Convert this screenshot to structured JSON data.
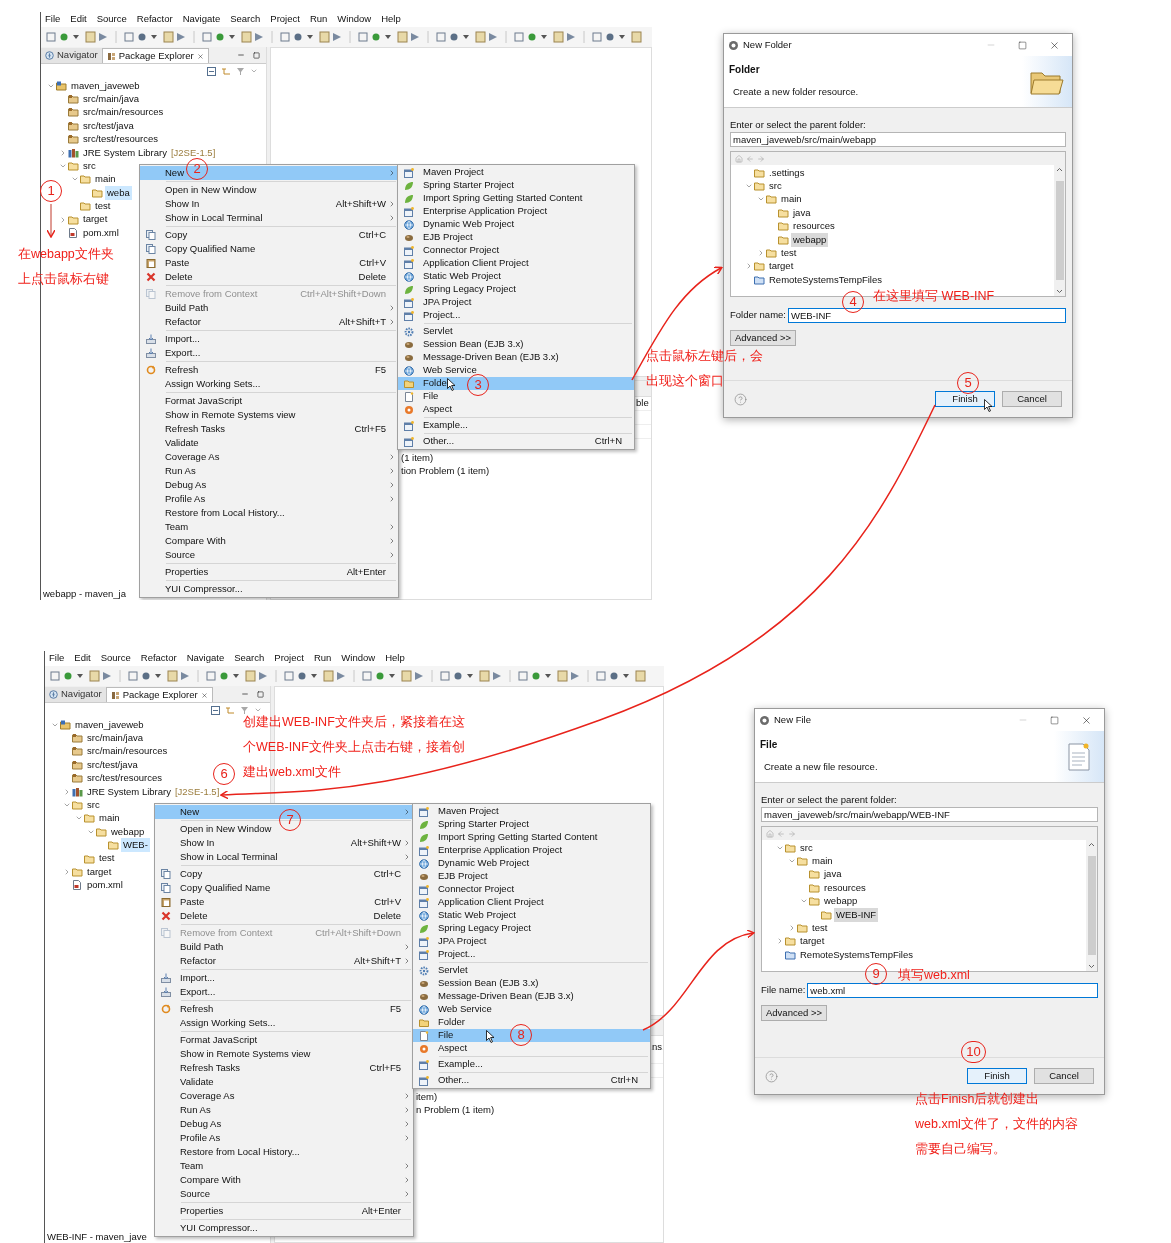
{
  "panels": [
    {
      "menu_bar": [
        "File",
        "Edit",
        "Source",
        "Refactor",
        "Navigate",
        "Search",
        "Project",
        "Run",
        "Window",
        "Help"
      ],
      "tabs": [
        {
          "label": "Navigator",
          "selected": false
        },
        {
          "label": "Package Explorer",
          "selected": true
        }
      ],
      "tree": [
        {
          "label": "maven_javeweb",
          "kind": "project",
          "expanded": true,
          "selected": false,
          "children": [
            {
              "label": "src/main/java",
              "kind": "package",
              "selected": false
            },
            {
              "label": "src/main/resources",
              "kind": "package",
              "selected": false
            },
            {
              "label": "src/test/java",
              "kind": "package",
              "selected": false
            },
            {
              "label": "src/test/resources",
              "kind": "package",
              "selected": false
            },
            {
              "label": "JRE System Library",
              "decoration": "[J2SE-1.5]",
              "kind": "library",
              "expanded": false,
              "selected": false
            },
            {
              "label": "src",
              "kind": "folder",
              "expanded": true,
              "selected": false,
              "children": [
                {
                  "label": "main",
                  "kind": "folder",
                  "expanded": true,
                  "selected": false,
                  "children": [
                    {
                      "label": "weba",
                      "kind": "folder",
                      "selected": true
                    }
                  ]
                },
                {
                  "label": "test",
                  "kind": "folder",
                  "selected": false
                }
              ]
            },
            {
              "label": "target",
              "kind": "folder",
              "expanded": false,
              "selected": false
            },
            {
              "label": "pom.xml",
              "kind": "xml",
              "selected": false
            }
          ]
        }
      ],
      "status": "webapp - maven_ja",
      "fragments": [
        "ble",
        "(1 item)",
        "tion Problem (1 item)"
      ],
      "context_menu": {
        "groups": [
          [
            {
              "label": "New",
              "submenu": true,
              "selected": true,
              "disabled": false
            }
          ],
          [
            {
              "label": "Open in New Window",
              "submenu": false,
              "selected": false,
              "disabled": false
            },
            {
              "label": "Show In",
              "shortcut": "Alt+Shift+W",
              "submenu": true,
              "selected": false,
              "disabled": false
            },
            {
              "label": "Show in Local Terminal",
              "submenu": true,
              "selected": false,
              "disabled": false
            }
          ],
          [
            {
              "label": "Copy",
              "shortcut": "Ctrl+C",
              "kind": "copy",
              "submenu": false,
              "selected": false,
              "disabled": false
            },
            {
              "label": "Copy Qualified Name",
              "kind": "copy",
              "submenu": false,
              "selected": false,
              "disabled": false
            },
            {
              "label": "Paste",
              "shortcut": "Ctrl+V",
              "kind": "paste",
              "submenu": false,
              "selected": false,
              "disabled": false
            },
            {
              "label": "Delete",
              "shortcut": "Delete",
              "kind": "delete",
              "submenu": false,
              "selected": false,
              "disabled": false
            }
          ],
          [
            {
              "label": "Remove from Context",
              "shortcut": "Ctrl+Alt+Shift+Down",
              "kind": "remove",
              "submenu": false,
              "selected": false,
              "disabled": true
            },
            {
              "label": "Build Path",
              "submenu": true,
              "selected": false,
              "disabled": false
            },
            {
              "label": "Refactor",
              "shortcut": "Alt+Shift+T",
              "submenu": true,
              "selected": false,
              "disabled": false
            }
          ],
          [
            {
              "label": "Import...",
              "kind": "import",
              "submenu": false,
              "selected": false,
              "disabled": false
            },
            {
              "label": "Export...",
              "kind": "export",
              "submenu": false,
              "selected": false,
              "disabled": false
            }
          ],
          [
            {
              "label": "Refresh",
              "shortcut": "F5",
              "kind": "refresh",
              "submenu": false,
              "selected": false,
              "disabled": false
            },
            {
              "label": "Assign Working Sets...",
              "submenu": false,
              "selected": false,
              "disabled": false
            }
          ],
          [
            {
              "label": "Format JavaScript",
              "submenu": false,
              "selected": false,
              "disabled": false
            },
            {
              "label": "Show in Remote Systems view",
              "submenu": false,
              "selected": false,
              "disabled": false
            },
            {
              "label": "Refresh Tasks",
              "shortcut": "Ctrl+F5",
              "submenu": false,
              "selected": false,
              "disabled": false
            },
            {
              "label": "Validate",
              "submenu": false,
              "selected": false,
              "disabled": false
            },
            {
              "label": "Coverage As",
              "submenu": true,
              "selected": false,
              "disabled": false
            },
            {
              "label": "Run As",
              "submenu": true,
              "selected": false,
              "disabled": false
            },
            {
              "label": "Debug As",
              "submenu": true,
              "selected": false,
              "disabled": false
            },
            {
              "label": "Profile As",
              "submenu": true,
              "selected": false,
              "disabled": false
            },
            {
              "label": "Restore from Local History...",
              "submenu": false,
              "selected": false,
              "disabled": false
            },
            {
              "label": "Team",
              "submenu": true,
              "selected": false,
              "disabled": false
            },
            {
              "label": "Compare With",
              "submenu": true,
              "selected": false,
              "disabled": false
            },
            {
              "label": "Source",
              "submenu": true,
              "selected": false,
              "disabled": false
            }
          ],
          [
            {
              "label": "Properties",
              "shortcut": "Alt+Enter",
              "submenu": false,
              "selected": false,
              "disabled": false
            }
          ],
          [
            {
              "label": "YUI Compressor...",
              "submenu": false,
              "selected": false,
              "disabled": false
            }
          ]
        ]
      },
      "new_submenu": {
        "groups": [
          [
            {
              "label": "Maven Project",
              "kind": "wizard",
              "selected": false
            },
            {
              "label": "Spring Starter Project",
              "kind": "spring",
              "selected": false
            },
            {
              "label": "Import Spring Getting Started Content",
              "kind": "spring",
              "selected": false
            },
            {
              "label": "Enterprise Application Project",
              "kind": "wizard",
              "selected": false
            },
            {
              "label": "Dynamic Web Project",
              "kind": "web",
              "selected": false
            },
            {
              "label": "EJB Project",
              "kind": "bean",
              "selected": false
            },
            {
              "label": "Connector Project",
              "kind": "wizard",
              "selected": false
            },
            {
              "label": "Application Client Project",
              "kind": "wizard",
              "selected": false
            },
            {
              "label": "Static Web Project",
              "kind": "web",
              "selected": false
            },
            {
              "label": "Spring Legacy Project",
              "kind": "spring",
              "selected": false
            },
            {
              "label": "JPA Project",
              "kind": "wizard",
              "selected": false
            },
            {
              "label": "Project...",
              "kind": "wizard",
              "selected": false
            }
          ],
          [
            {
              "label": "Servlet",
              "kind": "servlet",
              "selected": false
            },
            {
              "label": "Session Bean (EJB 3.x)",
              "kind": "bean",
              "selected": false
            },
            {
              "label": "Message-Driven Bean (EJB 3.x)",
              "kind": "bean",
              "selected": false
            },
            {
              "label": "Web Service",
              "kind": "web",
              "selected": false
            },
            {
              "label": "Folder",
              "kind": "folder",
              "selected": true
            },
            {
              "label": "File",
              "kind": "file",
              "selected": false
            },
            {
              "label": "Aspect",
              "kind": "aspect",
              "selected": false
            }
          ],
          [
            {
              "label": "Example...",
              "kind": "wizard",
              "selected": false
            }
          ],
          [
            {
              "label": "Other...",
              "shortcut": "Ctrl+N",
              "kind": "wizard",
              "selected": false
            }
          ]
        ]
      }
    },
    {
      "menu_bar": [
        "File",
        "Edit",
        "Source",
        "Refactor",
        "Navigate",
        "Search",
        "Project",
        "Run",
        "Window",
        "Help"
      ],
      "tabs": [
        {
          "label": "Navigator",
          "selected": false
        },
        {
          "label": "Package Explorer",
          "selected": true
        }
      ],
      "tree": [
        {
          "label": "maven_javeweb",
          "kind": "project",
          "expanded": true,
          "selected": false,
          "children": [
            {
              "label": "src/main/java",
              "kind": "package",
              "selected": false
            },
            {
              "label": "src/main/resources",
              "kind": "package",
              "selected": false
            },
            {
              "label": "src/test/java",
              "kind": "package",
              "selected": false
            },
            {
              "label": "src/test/resources",
              "kind": "package",
              "selected": false
            },
            {
              "label": "JRE System Library",
              "decoration": "[J2SE-1.5]",
              "kind": "library",
              "expanded": false,
              "selected": false
            },
            {
              "label": "src",
              "kind": "folder",
              "expanded": true,
              "selected": false,
              "children": [
                {
                  "label": "main",
                  "kind": "folder",
                  "expanded": true,
                  "selected": false,
                  "children": [
                    {
                      "label": "webapp",
                      "kind": "folder",
                      "expanded": true,
                      "selected": false,
                      "children": [
                        {
                          "label": "WEB-",
                          "kind": "folder",
                          "selected": true
                        }
                      ]
                    }
                  ]
                },
                {
                  "label": "test",
                  "kind": "folder",
                  "selected": false
                }
              ]
            },
            {
              "label": "target",
              "kind": "folder",
              "expanded": false,
              "selected": false
            },
            {
              "label": "pom.xml",
              "kind": "xml",
              "selected": false
            }
          ]
        }
      ],
      "status": "WEB-INF - maven_jave",
      "fragments": [
        "ns",
        "item)",
        "n Problem (1 item)"
      ],
      "context_menu": {
        "groups": [
          [
            {
              "label": "New",
              "submenu": true,
              "selected": true,
              "disabled": false
            }
          ],
          [
            {
              "label": "Open in New Window",
              "submenu": false,
              "selected": false,
              "disabled": false
            },
            {
              "label": "Show In",
              "shortcut": "Alt+Shift+W",
              "submenu": true,
              "selected": false,
              "disabled": false
            },
            {
              "label": "Show in Local Terminal",
              "submenu": true,
              "selected": false,
              "disabled": false
            }
          ],
          [
            {
              "label": "Copy",
              "shortcut": "Ctrl+C",
              "kind": "copy",
              "submenu": false,
              "selected": false,
              "disabled": false
            },
            {
              "label": "Copy Qualified Name",
              "kind": "copy",
              "submenu": false,
              "selected": false,
              "disabled": false
            },
            {
              "label": "Paste",
              "shortcut": "Ctrl+V",
              "kind": "paste",
              "submenu": false,
              "selected": false,
              "disabled": false
            },
            {
              "label": "Delete",
              "shortcut": "Delete",
              "kind": "delete",
              "submenu": false,
              "selected": false,
              "disabled": false
            }
          ],
          [
            {
              "label": "Remove from Context",
              "shortcut": "Ctrl+Alt+Shift+Down",
              "kind": "remove",
              "submenu": false,
              "selected": false,
              "disabled": true
            },
            {
              "label": "Build Path",
              "submenu": true,
              "selected": false,
              "disabled": false
            },
            {
              "label": "Refactor",
              "shortcut": "Alt+Shift+T",
              "submenu": true,
              "selected": false,
              "disabled": false
            }
          ],
          [
            {
              "label": "Import...",
              "kind": "import",
              "submenu": false,
              "selected": false,
              "disabled": false
            },
            {
              "label": "Export...",
              "kind": "export",
              "submenu": false,
              "selected": false,
              "disabled": false
            }
          ],
          [
            {
              "label": "Refresh",
              "shortcut": "F5",
              "kind": "refresh",
              "submenu": false,
              "selected": false,
              "disabled": false
            },
            {
              "label": "Assign Working Sets...",
              "submenu": false,
              "selected": false,
              "disabled": false
            }
          ],
          [
            {
              "label": "Format JavaScript",
              "submenu": false,
              "selected": false,
              "disabled": false
            },
            {
              "label": "Show in Remote Systems view",
              "submenu": false,
              "selected": false,
              "disabled": false
            },
            {
              "label": "Refresh Tasks",
              "shortcut": "Ctrl+F5",
              "submenu": false,
              "selected": false,
              "disabled": false
            },
            {
              "label": "Validate",
              "submenu": false,
              "selected": false,
              "disabled": false
            },
            {
              "label": "Coverage As",
              "submenu": true,
              "selected": false,
              "disabled": false
            },
            {
              "label": "Run As",
              "submenu": true,
              "selected": false,
              "disabled": false
            },
            {
              "label": "Debug As",
              "submenu": true,
              "selected": false,
              "disabled": false
            },
            {
              "label": "Profile As",
              "submenu": true,
              "selected": false,
              "disabled": false
            },
            {
              "label": "Restore from Local History...",
              "submenu": false,
              "selected": false,
              "disabled": false
            },
            {
              "label": "Team",
              "submenu": true,
              "selected": false,
              "disabled": false
            },
            {
              "label": "Compare With",
              "submenu": true,
              "selected": false,
              "disabled": false
            },
            {
              "label": "Source",
              "submenu": true,
              "selected": false,
              "disabled": false
            }
          ],
          [
            {
              "label": "Properties",
              "shortcut": "Alt+Enter",
              "submenu": false,
              "selected": false,
              "disabled": false
            }
          ],
          [
            {
              "label": "YUI Compressor...",
              "submenu": false,
              "selected": false,
              "disabled": false
            }
          ]
        ]
      },
      "new_submenu": {
        "groups": [
          [
            {
              "label": "Maven Project",
              "kind": "wizard",
              "selected": false
            },
            {
              "label": "Spring Starter Project",
              "kind": "spring",
              "selected": false
            },
            {
              "label": "Import Spring Getting Started Content",
              "kind": "spring",
              "selected": false
            },
            {
              "label": "Enterprise Application Project",
              "kind": "wizard",
              "selected": false
            },
            {
              "label": "Dynamic Web Project",
              "kind": "web",
              "selected": false
            },
            {
              "label": "EJB Project",
              "kind": "bean",
              "selected": false
            },
            {
              "label": "Connector Project",
              "kind": "wizard",
              "selected": false
            },
            {
              "label": "Application Client Project",
              "kind": "wizard",
              "selected": false
            },
            {
              "label": "Static Web Project",
              "kind": "web",
              "selected": false
            },
            {
              "label": "Spring Legacy Project",
              "kind": "spring",
              "selected": false
            },
            {
              "label": "JPA Project",
              "kind": "wizard",
              "selected": false
            },
            {
              "label": "Project...",
              "kind": "wizard",
              "selected": false
            }
          ],
          [
            {
              "label": "Servlet",
              "kind": "servlet",
              "selected": false
            },
            {
              "label": "Session Bean (EJB 3.x)",
              "kind": "bean",
              "selected": false
            },
            {
              "label": "Message-Driven Bean (EJB 3.x)",
              "kind": "bean",
              "selected": false
            },
            {
              "label": "Web Service",
              "kind": "web",
              "selected": false
            },
            {
              "label": "Folder",
              "kind": "folder",
              "selected": false
            },
            {
              "label": "File",
              "kind": "file",
              "selected": true
            },
            {
              "label": "Aspect",
              "kind": "aspect",
              "selected": false
            }
          ],
          [
            {
              "label": "Example...",
              "kind": "wizard",
              "selected": false
            }
          ],
          [
            {
              "label": "Other...",
              "shortcut": "Ctrl+N",
              "kind": "wizard",
              "selected": false
            }
          ]
        ]
      }
    }
  ],
  "dialogs": [
    {
      "kind": "folder",
      "title": "New Folder",
      "heading": "Folder",
      "description": "Create a new folder resource.",
      "parent_label": "Enter or select the parent folder:",
      "parent_value": "maven_javeweb/src/main/webapp",
      "tree": [
        {
          "label": ".settings",
          "kind": "folder",
          "selected": false
        },
        {
          "label": "src",
          "kind": "folder",
          "expanded": true,
          "selected": false,
          "children": [
            {
              "label": "main",
              "kind": "folder",
              "expanded": true,
              "selected": false,
              "children": [
                {
                  "label": "java",
                  "kind": "folder",
                  "selected": false
                },
                {
                  "label": "resources",
                  "kind": "folder",
                  "selected": false
                },
                {
                  "label": "webapp",
                  "kind": "folder",
                  "selected": true
                }
              ]
            },
            {
              "label": "test",
              "kind": "folder",
              "expanded": false,
              "selected": false
            }
          ]
        },
        {
          "label": "target",
          "kind": "folder",
          "expanded": false,
          "selected": false
        },
        {
          "label": "RemoteSystemsTempFiles",
          "kind": "remote",
          "selected": false
        }
      ],
      "name_label": "Folder name:",
      "name_value": "WEB-INF",
      "advanced_button": "Advanced >>",
      "finish_button": "Finish",
      "cancel_button": "Cancel"
    },
    {
      "kind": "file",
      "title": "New File",
      "heading": "File",
      "description": "Create a new file resource.",
      "parent_label": "Enter or select the parent folder:",
      "parent_value": "maven_javeweb/src/main/webapp/WEB-INF",
      "tree": [
        {
          "label": "src",
          "kind": "folder",
          "expanded": true,
          "selected": false,
          "children": [
            {
              "label": "main",
              "kind": "folder",
              "expanded": true,
              "selected": false,
              "children": [
                {
                  "label": "java",
                  "kind": "folder",
                  "selected": false
                },
                {
                  "label": "resources",
                  "kind": "folder",
                  "selected": false
                },
                {
                  "label": "webapp",
                  "kind": "folder",
                  "expanded": true,
                  "selected": false,
                  "children": [
                    {
                      "label": "WEB-INF",
                      "kind": "folder",
                      "selected": true
                    }
                  ]
                }
              ]
            },
            {
              "label": "test",
              "kind": "folder",
              "expanded": false,
              "selected": false
            }
          ]
        },
        {
          "label": "target",
          "kind": "folder",
          "expanded": false,
          "selected": false
        },
        {
          "label": "RemoteSystemsTempFiles",
          "kind": "remote",
          "selected": false
        }
      ],
      "name_label": "File name:",
      "name_value": "web.xml",
      "advanced_button": "Advanced >>",
      "finish_button": "Finish",
      "cancel_button": "Cancel"
    }
  ],
  "annotations": {
    "step_numbers": [
      "1",
      "2",
      "3",
      "4",
      "5",
      "6",
      "7",
      "8",
      "9",
      "10"
    ],
    "notes": [
      {
        "lines": [
          "在webapp文件夹",
          "上点击鼠标右键"
        ]
      },
      {
        "lines": [
          "在这里填写 WEB-INF"
        ]
      },
      {
        "lines": [
          "点击鼠标左键后，会",
          "出现这个窗口"
        ]
      },
      {
        "lines": [
          "创建出WEB-INF文件夹后，紧接着在这",
          "个WEB-INF文件夹上点击右键，接着创",
          "建出web.xml文件"
        ]
      },
      {
        "lines": [
          "填写web.xml"
        ]
      },
      {
        "lines": [
          "点击Finish后就创建出",
          "web.xml文件了，文件的内容",
          "需要自己编写。"
        ]
      }
    ]
  }
}
